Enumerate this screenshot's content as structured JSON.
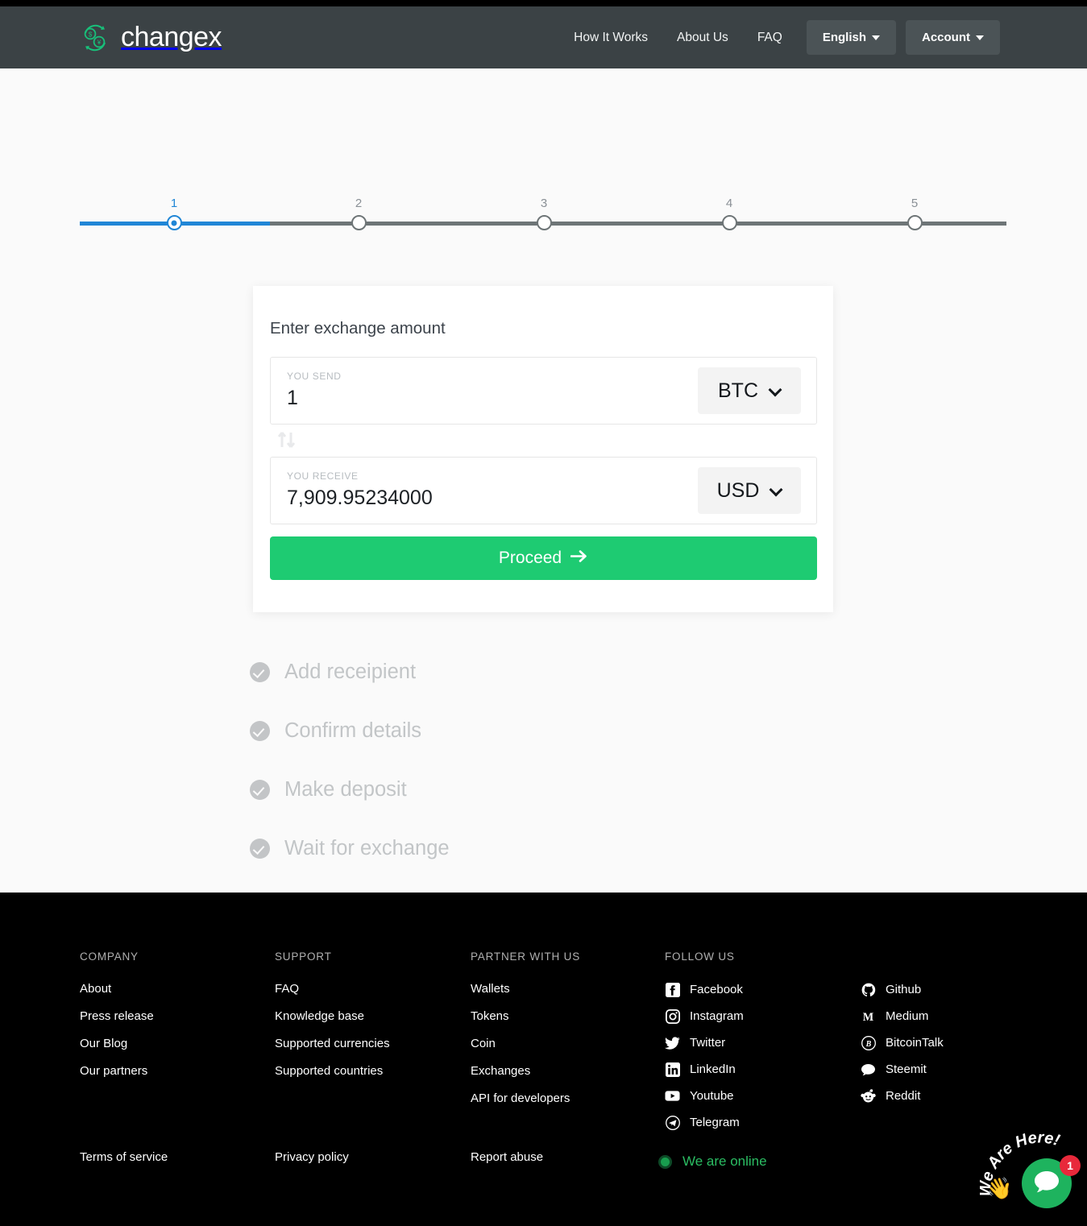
{
  "brand": {
    "name": "changex",
    "logo_icon": "exchange-coins-icon"
  },
  "header": {
    "nav_links": [
      {
        "label": "How It Works"
      },
      {
        "label": "About Us"
      },
      {
        "label": "FAQ"
      }
    ],
    "language_button": {
      "label": "English",
      "icon": "caret-down-icon"
    },
    "account_button": {
      "label": "Account",
      "icon": "caret-down-icon"
    }
  },
  "stepper": {
    "active_step": 1,
    "steps": [
      {
        "number": "1"
      },
      {
        "number": "2"
      },
      {
        "number": "3"
      },
      {
        "number": "4"
      },
      {
        "number": "5"
      }
    ],
    "active_color": "#2086d6",
    "inactive_color": "#6e7577"
  },
  "exchange_card": {
    "title": "Enter exchange amount",
    "send": {
      "label": "YOU SEND",
      "value": "1",
      "currency": "BTC",
      "currency_icon": "chevron-down-icon"
    },
    "receive": {
      "label": "YOU RECEIVE",
      "value": "7,909.95234000",
      "currency": "USD",
      "currency_icon": "chevron-down-icon"
    },
    "swap_icon": "swap-vertical-icon",
    "proceed_button": {
      "label": "Proceed",
      "icon": "arrow-right-icon",
      "color": "#1ecb72"
    }
  },
  "pending_steps": [
    {
      "label": "Add receipient",
      "icon": "check-circle-icon"
    },
    {
      "label": "Confirm details",
      "icon": "check-circle-icon"
    },
    {
      "label": "Make deposit",
      "icon": "check-circle-icon"
    },
    {
      "label": "Wait for exchange",
      "icon": "check-circle-icon"
    }
  ],
  "footer": {
    "columns": [
      {
        "heading": "COMPANY",
        "links": [
          {
            "label": "About"
          },
          {
            "label": "Press release"
          },
          {
            "label": "Our Blog"
          },
          {
            "label": "Our partners"
          }
        ]
      },
      {
        "heading": "SUPPORT",
        "links": [
          {
            "label": "FAQ"
          },
          {
            "label": "Knowledge base"
          },
          {
            "label": "Supported currencies"
          },
          {
            "label": "Supported countries"
          }
        ]
      },
      {
        "heading": "PARTNER WITH US",
        "links": [
          {
            "label": "Wallets"
          },
          {
            "label": "Tokens"
          },
          {
            "label": "Coin"
          },
          {
            "label": "Exchanges"
          },
          {
            "label": "API for developers"
          }
        ]
      }
    ],
    "follow_us": {
      "heading": "FOLLOW US",
      "column_one": [
        {
          "label": "Facebook",
          "icon": "facebook-icon"
        },
        {
          "label": "Instagram",
          "icon": "instagram-icon"
        },
        {
          "label": "Twitter",
          "icon": "twitter-icon"
        },
        {
          "label": "LinkedIn",
          "icon": "linkedin-icon"
        },
        {
          "label": "Youtube",
          "icon": "youtube-icon"
        },
        {
          "label": "Telegram",
          "icon": "telegram-icon"
        }
      ],
      "column_two": [
        {
          "label": "Github",
          "icon": "github-icon"
        },
        {
          "label": "Medium",
          "icon": "medium-icon"
        },
        {
          "label": "BitcoinTalk",
          "icon": "bitcoin-icon"
        },
        {
          "label": "Steemit",
          "icon": "speech-bubble-icon"
        },
        {
          "label": "Reddit",
          "icon": "reddit-icon"
        }
      ]
    },
    "bottom_links": [
      {
        "label": "Terms of service"
      },
      {
        "label": "Privacy policy"
      },
      {
        "label": "Report abuse"
      }
    ],
    "status": {
      "label": "We are online",
      "icon": "status-dot-icon",
      "color": "#2bbd63"
    }
  },
  "chat_widget": {
    "caption": "We Are Here!",
    "badge_count": "1",
    "bubble_icon": "chat-bubble-icon",
    "wave_icon": "waving-hand-icon",
    "bubble_color": "#1eb35e",
    "badge_color": "#e8293b"
  }
}
